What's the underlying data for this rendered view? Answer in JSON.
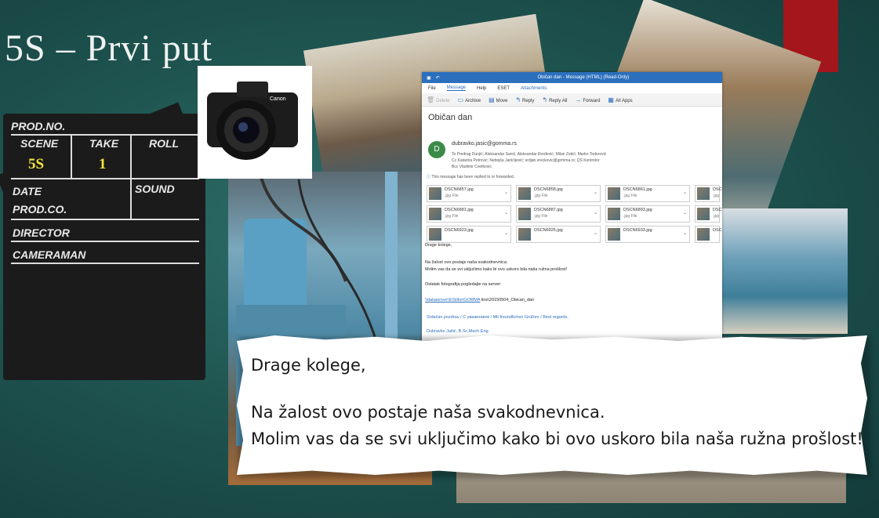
{
  "slide": {
    "title": "5S – Prvi put"
  },
  "clapperboard": {
    "prod_no": "PROD.NO.",
    "scene_label": "SCENE",
    "take_label": "TAKE",
    "roll_label": "ROLL",
    "scene_value": "5S",
    "take_value": "1",
    "date_label": "DATE",
    "sound_label": "SOUND",
    "prod_co_label": "PROD.CO.",
    "director_label": "DIRECTOR",
    "cameraman_label": "CAMERAMAN"
  },
  "outlook": {
    "window_title": "Običan dan - Message (HTML) (Read-Only)",
    "menu": [
      "File",
      "Message",
      "Help",
      "ESET",
      "Attachments"
    ],
    "toolbar": [
      "Delete",
      "Archive",
      "Move",
      "Reply",
      "Reply All",
      "Forward",
      "All Apps"
    ],
    "subject": "Običan dan",
    "sender_initial": "D",
    "sender_email": "dubravko.jasic@gomma.rs",
    "to_line": "To  Predrag Dunjić; Aleksandar Sanić; Aleksandar Đorđević; Milan Zekić; Marko Todorović",
    "cc_line": "Cc  Katarina Petrović; Nebojša Janićijević; srdjan.vreckovic@gomma.rs; QS Kontrolor",
    "bcc_line": "Bcc  Vladimir Cvetković",
    "info_bar": "This message has been replied to or forwarded.",
    "attachments": [
      {
        "name": "DSCN6857.jpg",
        "type": ".jpg File"
      },
      {
        "name": "DSCN6858.jpg",
        "type": ".jpg File"
      },
      {
        "name": "DSCN6861.jpg",
        "type": ".jpg File"
      },
      {
        "name": "DSC",
        "type": ".jpg"
      },
      {
        "name": "DSCN6881.jpg",
        "type": ".jpg File"
      },
      {
        "name": "DSCN6887.jpg",
        "type": ".jpg File"
      },
      {
        "name": "DSCN6893.jpg",
        "type": ".jpg File"
      },
      {
        "name": "DSC",
        "type": ".jpg"
      },
      {
        "name": "DSCN6923.jpg",
        "type": ""
      },
      {
        "name": "DSCN6925.jpg",
        "type": ""
      },
      {
        "name": "DSCN6933.jpg",
        "type": ""
      },
      {
        "name": "DSC",
        "type": ""
      }
    ],
    "body": {
      "greeting": "Drage kolege,",
      "line1": "Na žalost ovo postaje naša svakodnevnica.",
      "line2": "Molim vas da se svi uključimo kako bi ovo uskoro bila naša ružna prošlost!",
      "line3": "Ostatak fotografija pogledajte na server:",
      "link": "\\\\dataserver\\E\\Slike\\GOMMA",
      "link_rest": " line\\20150504_Obican_dan",
      "signature": "Srdačan pozdrav / С уважением / Mit freundlichen Grüßen / Best regards,",
      "signature2": "Dubravko Jašić, B.Sc.Mech.Eng."
    }
  },
  "excerpt": {
    "greeting": "Drage kolege,",
    "line1": "Na žalost ovo postaje naša svakodnevnica.",
    "line2": "Molim vas da se svi uključimo kako bi ovo uskoro bila naša ružna prošlost!"
  },
  "colors": {
    "accent_red": "#a3161b",
    "outlook_blue": "#2b6fbd",
    "clapper_yellow": "#f3e53a"
  }
}
